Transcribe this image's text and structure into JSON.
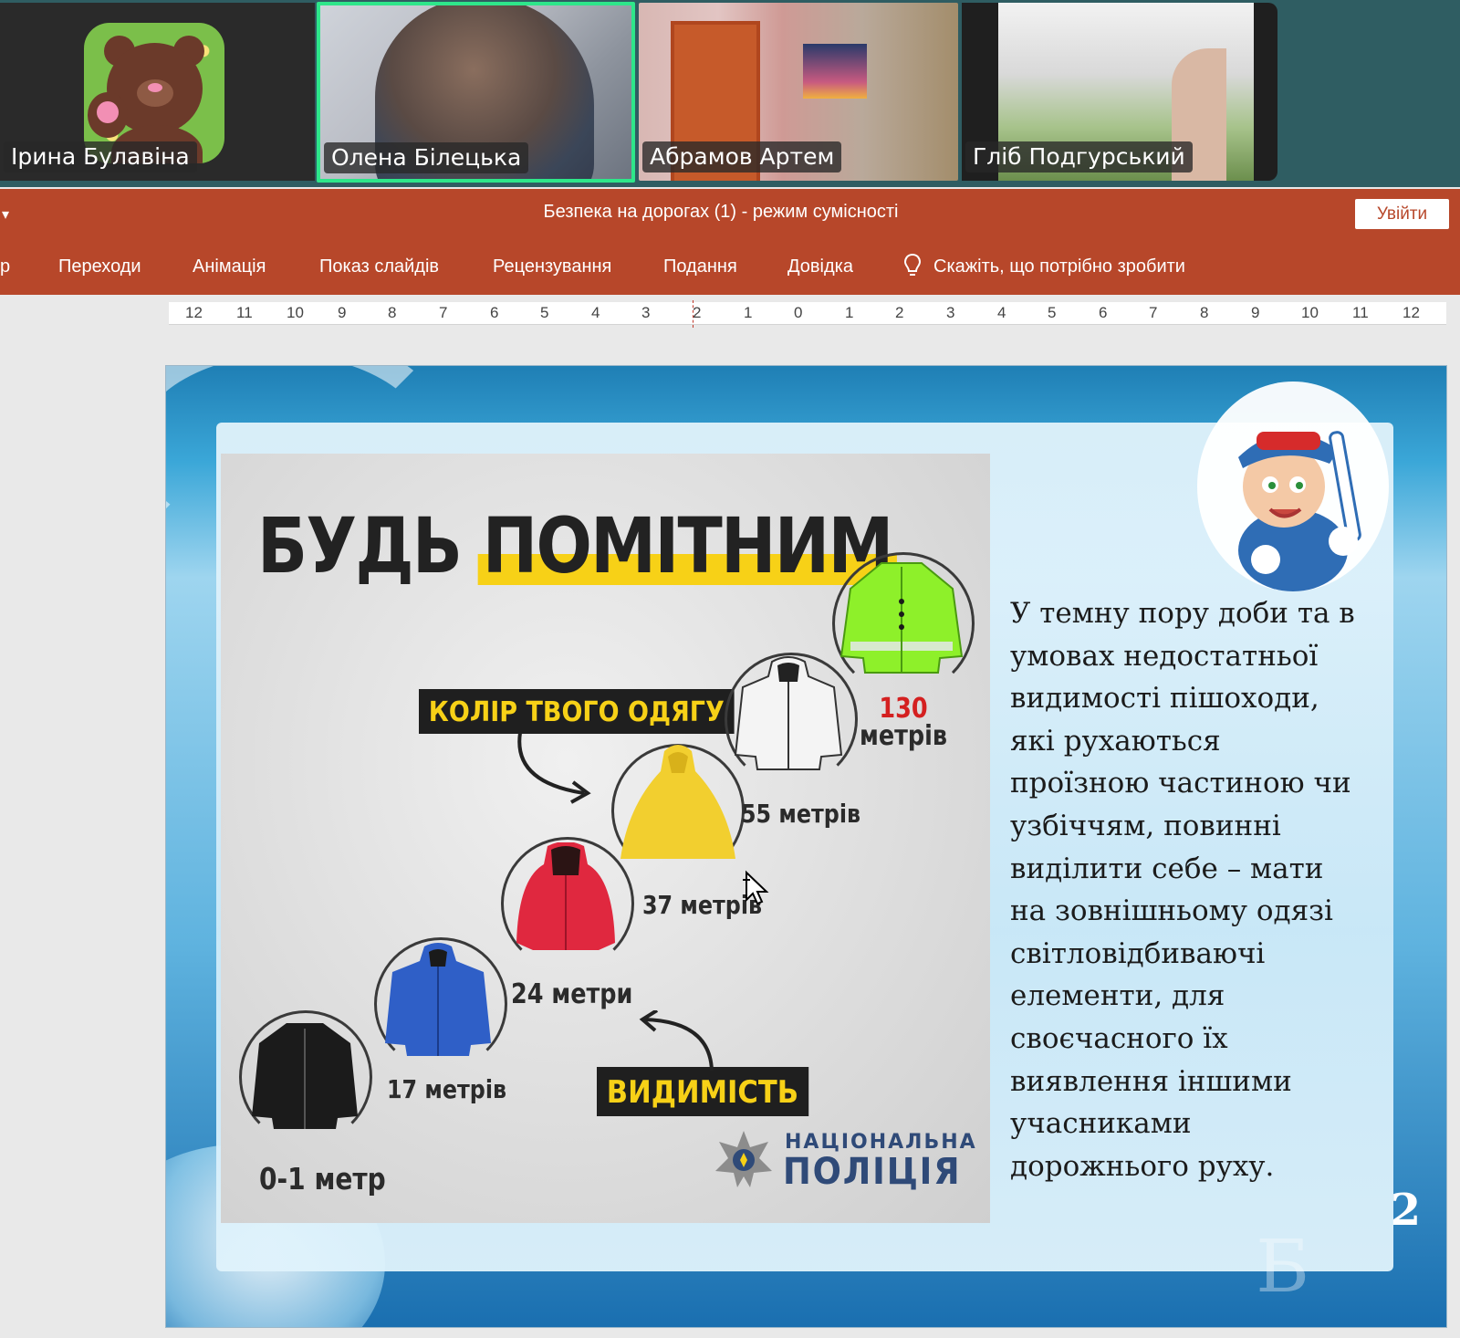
{
  "participants": [
    {
      "name": "Ірина Булавіна",
      "video": "avatar-bear"
    },
    {
      "name": "Олена Білецька",
      "video": "camera",
      "active_speaker": true
    },
    {
      "name": "Абрамов Артем",
      "video": "camera"
    },
    {
      "name": "Гліб Подгурський",
      "video": "camera"
    }
  ],
  "app": {
    "title": "Безпека на дорогах (1)  -  режим сумісності",
    "signin_label": "Увійти",
    "brand_color": "#b7472a"
  },
  "ribbon": {
    "tabs": [
      "p",
      "Переходи",
      "Анімація",
      "Показ слайдів",
      "Рецензування",
      "Подання",
      "Довідка"
    ],
    "tell_me": "Скажіть, що потрібно зробити"
  },
  "ruler": {
    "labels": [
      "12",
      "11",
      "10",
      "9",
      "8",
      "7",
      "6",
      "5",
      "4",
      "3",
      "2",
      "1",
      "0",
      "1",
      "2",
      "3",
      "4",
      "5",
      "6",
      "7",
      "8",
      "9",
      "10",
      "11",
      "12"
    ]
  },
  "slide": {
    "poster": {
      "title_word1": "БУДЬ",
      "title_word2": "ПОМІТНИМ",
      "tag_colour": "КОЛІР ТВОГО ОДЯГУ",
      "tag_visibility": "ВИДИМІСТЬ",
      "distances": {
        "black": "0-1 метр",
        "blue": "17 метрів",
        "red": "24 метри",
        "yellow": "37 метрів",
        "white": "55 метрів",
        "reflective_number": "130",
        "reflective_unit": "метрів"
      },
      "logo_line1": "НАЦІОНАЛЬНА",
      "logo_line2": "ПОЛІЦІЯ"
    },
    "body_lines": [
      "У темну пору доби та в",
      "умовах недостатньої",
      "видимості пішоходи,",
      "які рухаються",
      "проїзною частиною чи",
      "узбіччям, повинні",
      "виділити себе –  мати",
      "на зовнішньому одязі",
      "світловідбиваючі",
      "елементи,  для",
      "своєчасного їх",
      "виявлення  іншими",
      "учасниками",
      "дорожнього руху."
    ],
    "slide_number": "2"
  }
}
